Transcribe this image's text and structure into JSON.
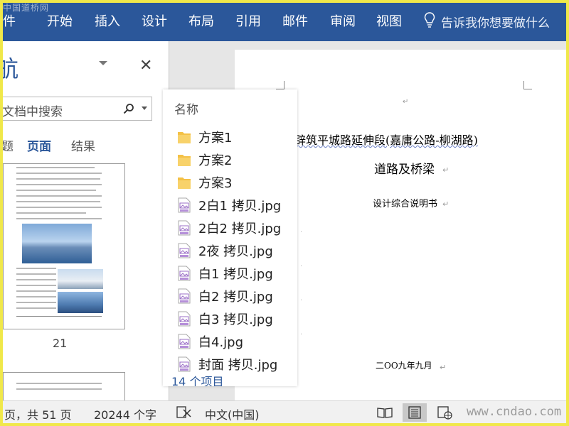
{
  "watermark_top": "中国道桥网",
  "watermark_bottom": "www.cndao.com",
  "ribbon": {
    "tabs": [
      "件",
      "开始",
      "插入",
      "设计",
      "布局",
      "引用",
      "邮件",
      "审阅",
      "视图"
    ],
    "tell_me": "告诉我你想要做什么",
    "bg_color": "#2b579a"
  },
  "nav": {
    "title": "航",
    "search_placeholder": "文档中搜索",
    "tabs": [
      {
        "label": "题",
        "active": false
      },
      {
        "label": "页面",
        "active": true
      },
      {
        "label": "结果",
        "active": false
      }
    ],
    "page_number": "21"
  },
  "document": {
    "line1": "辟筑平城路延伸段(嘉庸公路-柳湖路)",
    "line2": "道路及桥梁",
    "line3": "设计综合说明书",
    "date": "二OO九年九月"
  },
  "popup": {
    "header": "名称",
    "items": [
      {
        "type": "folder",
        "name": "方案1"
      },
      {
        "type": "folder",
        "name": "方案2"
      },
      {
        "type": "folder",
        "name": "方案3"
      },
      {
        "type": "jpg",
        "name": "2白1 拷贝.jpg"
      },
      {
        "type": "jpg",
        "name": "2白2 拷贝.jpg"
      },
      {
        "type": "jpg",
        "name": "2夜 拷贝.jpg"
      },
      {
        "type": "jpg",
        "name": "白1 拷贝.jpg"
      },
      {
        "type": "jpg",
        "name": "白2 拷贝.jpg"
      },
      {
        "type": "jpg",
        "name": "白3 拷贝.jpg"
      },
      {
        "type": "jpg",
        "name": "白4.jpg"
      },
      {
        "type": "jpg",
        "name": "封面 拷贝.jpg"
      }
    ],
    "count": "14 个项目"
  },
  "status": {
    "pages": "页，共 51 页",
    "words": "20244 个字",
    "language": "中文(中国)"
  }
}
